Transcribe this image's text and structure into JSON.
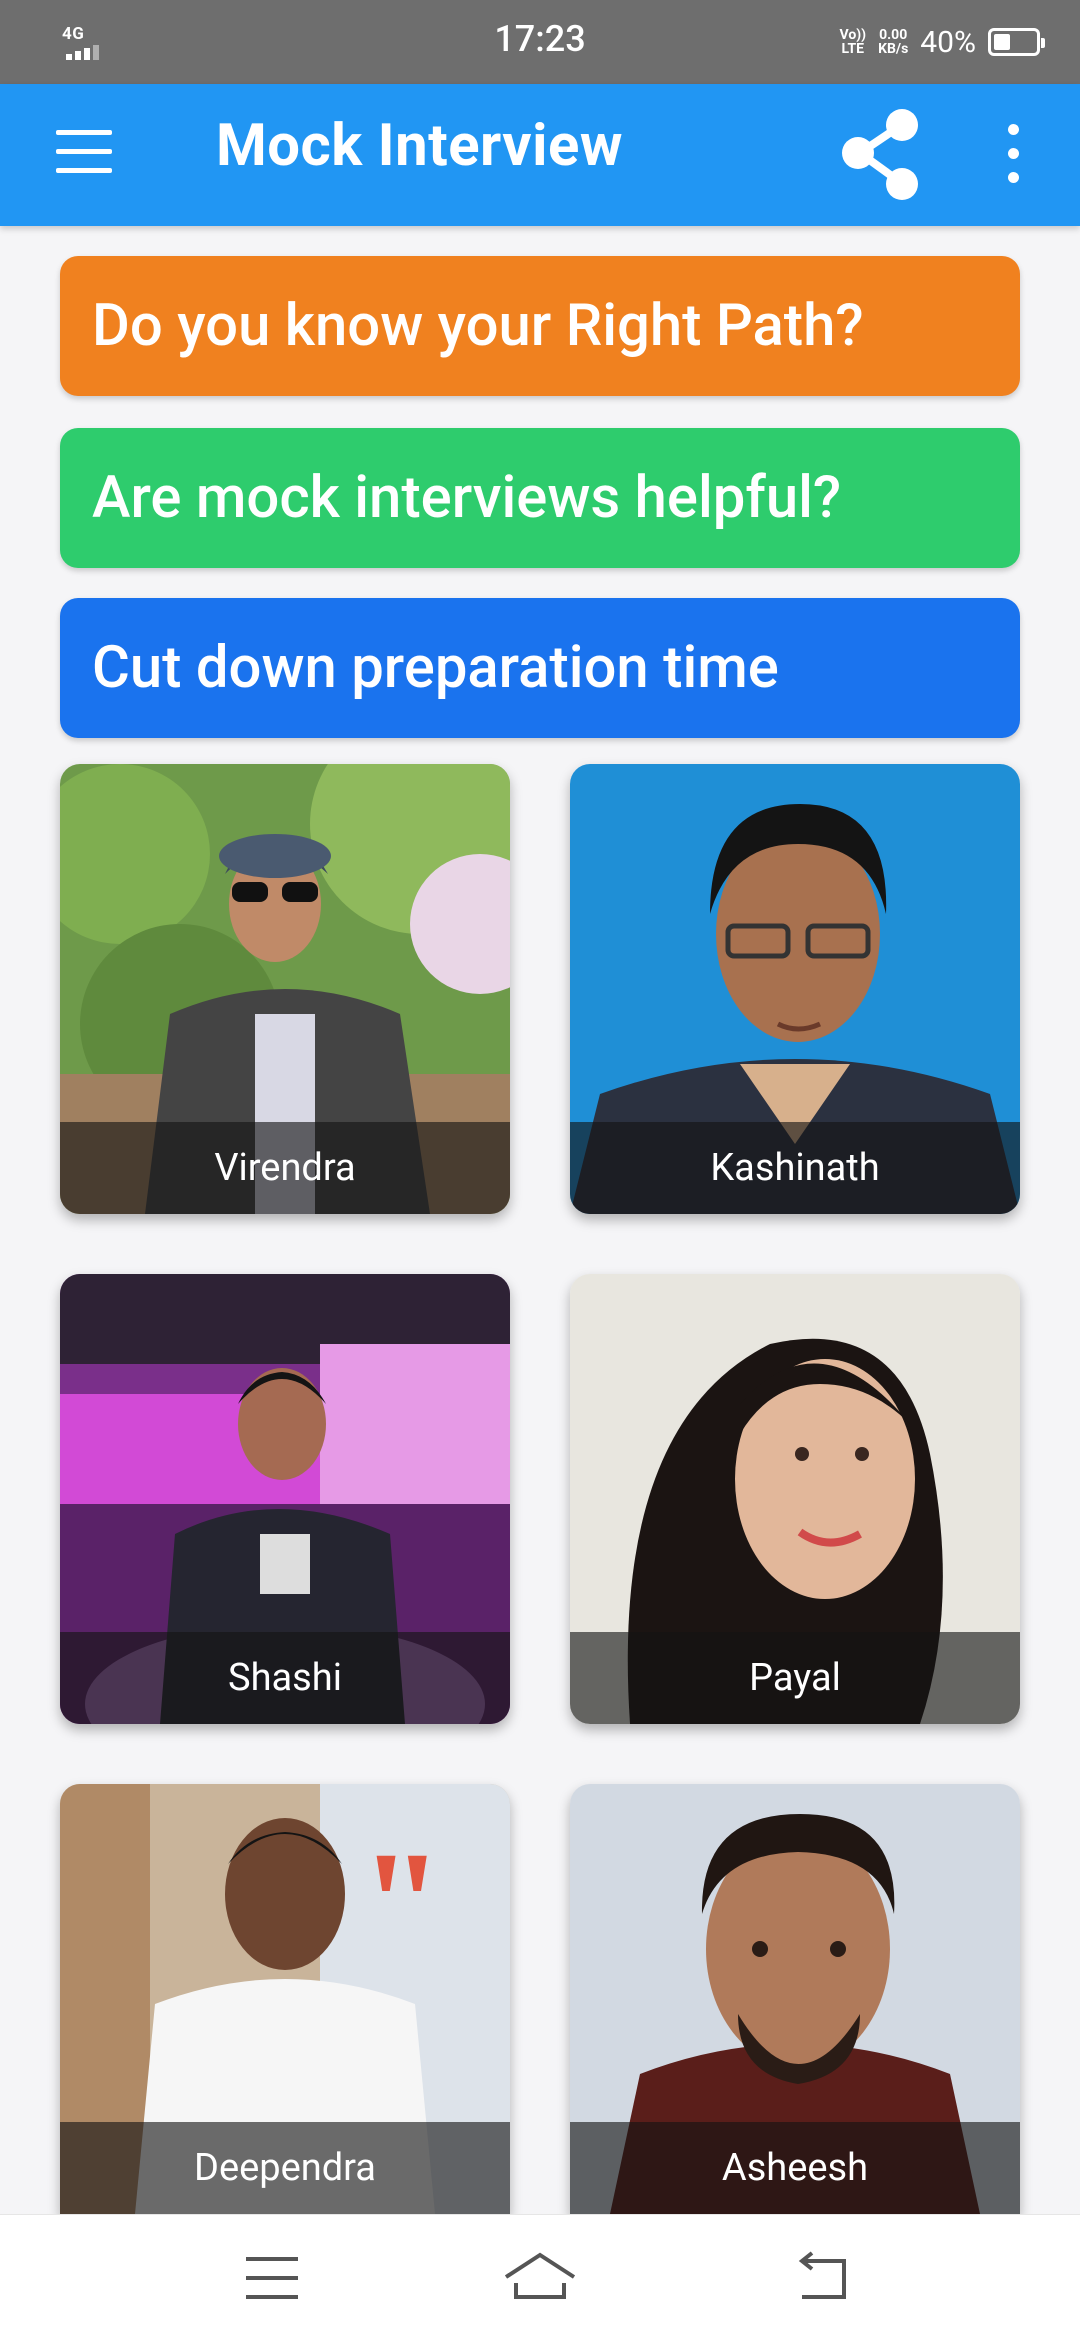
{
  "status_bar": {
    "network": "4G",
    "time": "17:23",
    "volte_top": "Vo))",
    "volte_bottom": "LTE",
    "speed_top": "0.00",
    "speed_bottom": "KB/s",
    "battery_percent": "40%",
    "battery_level": 0.4
  },
  "app_bar": {
    "title": "Mock Interview",
    "menu_icon": "hamburger-menu-icon",
    "share_icon": "share-icon",
    "more_icon": "more-vert-icon"
  },
  "banners": [
    {
      "label": "Do you know your Right Path?",
      "color": "#f0811f"
    },
    {
      "label": "Are mock interviews helpful?",
      "color": "#2ecc6d"
    },
    {
      "label": "Cut down preparation time",
      "color": "#1a73ee"
    }
  ],
  "interviewers": [
    {
      "name": "Virendra"
    },
    {
      "name": "Kashinath"
    },
    {
      "name": "Shashi"
    },
    {
      "name": "Payal"
    },
    {
      "name": "Deependra"
    },
    {
      "name": "Asheesh"
    }
  ],
  "nav_bar": {
    "menu_icon": "recent-apps-icon",
    "home_icon": "home-icon",
    "back_icon": "back-icon"
  },
  "colors": {
    "app_bar": "#2196f3",
    "status_bar": "#6e6e6e",
    "background": "#f5f5f7"
  }
}
